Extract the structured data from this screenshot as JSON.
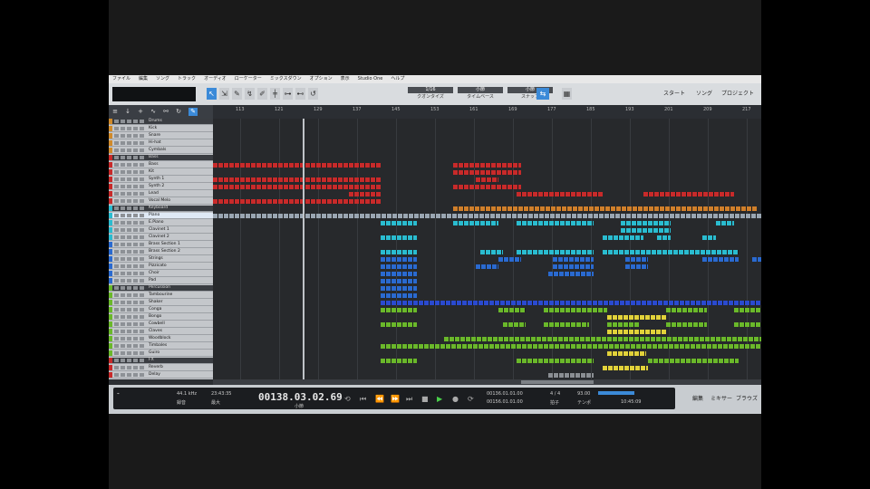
{
  "menu": [
    "ファイル",
    "編集",
    "ソング",
    "トラック",
    "オーディオ",
    "ローケーター",
    "ミックスダウン",
    "オプション",
    "表示",
    "Studio One",
    "ヘルプ"
  ],
  "toolbar": {
    "tools": [
      "↖",
      "⇲",
      "✎",
      "↯",
      "✐",
      "╪",
      "⊶",
      "⊷",
      "↺"
    ],
    "quantize": {
      "top": "1/16",
      "bottom": "クオンタイズ"
    },
    "timebase": {
      "top": "小節",
      "bottom": "タイムベース"
    },
    "snap": {
      "top": "小節",
      "bottom": "スナップ"
    },
    "right": {
      "start": "スタート",
      "song": "ソング",
      "project": "プロジェクト"
    }
  },
  "ruler": [
    "113",
    "121",
    "129",
    "137",
    "145",
    "153",
    "161",
    "169",
    "177",
    "185",
    "193",
    "201",
    "209",
    "217"
  ],
  "tracks": [
    {
      "name": "Drums",
      "type": "folder",
      "color": "#d08a2a"
    },
    {
      "name": "Kick",
      "type": "track",
      "color": "#d08a2a"
    },
    {
      "name": "Snare",
      "type": "track",
      "color": "#d08a2a"
    },
    {
      "name": "Hi-hat",
      "type": "track",
      "color": "#d08a2a"
    },
    {
      "name": "Cymbals",
      "type": "track",
      "color": "#d08a2a"
    },
    {
      "name": "Bass",
      "type": "folder",
      "color": "#c82a2a"
    },
    {
      "name": "Bass",
      "type": "track",
      "color": "#c82a2a"
    },
    {
      "name": "Kit",
      "type": "track",
      "color": "#c82a2a"
    },
    {
      "name": "Synth 1",
      "type": "track",
      "color": "#c82a2a"
    },
    {
      "name": "Synth 2",
      "type": "track",
      "color": "#c82a2a"
    },
    {
      "name": "Lead",
      "type": "track",
      "color": "#c82a2a"
    },
    {
      "name": "Vocal Melo",
      "type": "track",
      "color": "#c82a2a"
    },
    {
      "name": "Keyboard",
      "type": "folder",
      "color": "#2abcd0"
    },
    {
      "name": "Piano",
      "type": "track",
      "color": "#2abcd0",
      "selected": true
    },
    {
      "name": "E.Piano",
      "type": "track",
      "color": "#2abcd0"
    },
    {
      "name": "Clavinet 1",
      "type": "track",
      "color": "#2abcd0"
    },
    {
      "name": "Clavinet 2",
      "type": "track",
      "color": "#2abcd0"
    },
    {
      "name": "Brass Section 1",
      "type": "track",
      "color": "#2a6ad0"
    },
    {
      "name": "Brass Section 2",
      "type": "track",
      "color": "#2a6ad0"
    },
    {
      "name": "Strings",
      "type": "track",
      "color": "#2a6ad0"
    },
    {
      "name": "Pizzicato",
      "type": "track",
      "color": "#2a6ad0"
    },
    {
      "name": "Choir",
      "type": "track",
      "color": "#2a6ad0"
    },
    {
      "name": "Pad",
      "type": "track",
      "color": "#2a6ad0"
    },
    {
      "name": "Percussion",
      "type": "folder",
      "color": "#6ab82a"
    },
    {
      "name": "Tambourine",
      "type": "track",
      "color": "#6ab82a"
    },
    {
      "name": "Shaker",
      "type": "track",
      "color": "#6ab82a"
    },
    {
      "name": "Conga",
      "type": "track",
      "color": "#6ab82a"
    },
    {
      "name": "Bongo",
      "type": "track",
      "color": "#6ab82a"
    },
    {
      "name": "Cowbell",
      "type": "track",
      "color": "#6ab82a"
    },
    {
      "name": "Claves",
      "type": "track",
      "color": "#6ab82a"
    },
    {
      "name": "Woodblock",
      "type": "track",
      "color": "#6ab82a"
    },
    {
      "name": "Timbales",
      "type": "track",
      "color": "#6ab82a"
    },
    {
      "name": "Guiro",
      "type": "track",
      "color": "#6ab82a"
    },
    {
      "name": "FX",
      "type": "folder",
      "color": "#c82a2a"
    },
    {
      "name": "Reverb",
      "type": "track",
      "color": "#c82a2a"
    },
    {
      "name": "Delay",
      "type": "track",
      "color": "#c82a2a"
    }
  ],
  "transport": {
    "sample_rate": "44.1 kHz",
    "record": "録音",
    "max": "最大",
    "time_label": "時間",
    "time_a": "23:43:35",
    "time_b": "10:45:09",
    "position": "00138.03.02.69",
    "position_unit": "小節",
    "loop_start": "00136.01.01.00",
    "loop_end": "00156.01.01.00",
    "meter": "4 / 4",
    "tempo": "93.00",
    "tempo_label": "テンポ",
    "meter_label": "拍子",
    "play_buttons": [
      "⟲",
      "⏮",
      "⏪",
      "⏩",
      "⏭",
      "■",
      "▶",
      "●",
      "⟳"
    ]
  },
  "right_buttons": [
    "編集",
    "ミキサー",
    "ブラウズ"
  ]
}
